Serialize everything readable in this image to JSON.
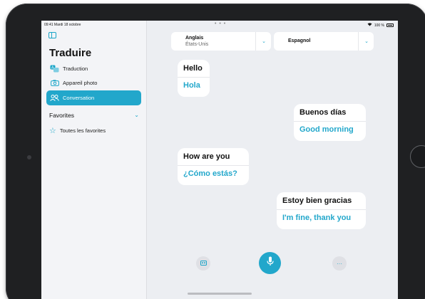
{
  "status_bar": {
    "time_date": "09:41  Mardi 18 octobre",
    "dots": "• • •",
    "battery": "100 %"
  },
  "sidebar": {
    "title": "Traduire",
    "items": [
      {
        "label": "Traduction",
        "icon": "translate-icon"
      },
      {
        "label": "Appareil photo",
        "icon": "camera-icon"
      },
      {
        "label": "Conversation",
        "icon": "people-icon",
        "active": true
      }
    ],
    "favorites": {
      "header": "Favorites",
      "items": [
        {
          "label": "Toutes les favorites",
          "icon": "star-icon"
        }
      ]
    }
  },
  "languages": {
    "source": {
      "name": "Anglais",
      "region": "États-Unis"
    },
    "target": {
      "name": "Espagnol"
    }
  },
  "conversation": [
    {
      "original": "Hello",
      "translation": "Hola"
    },
    {
      "original": "Buenos días",
      "translation": "Good morning"
    },
    {
      "original": "How are you",
      "translation": "¿Cómo estás?"
    },
    {
      "original": "Estoy bien gracias",
      "translation": "I'm fine, thank you"
    }
  ],
  "controls": {
    "view_icon": "view-mode-icon",
    "mic_icon": "microphone-icon",
    "more_icon": "ellipsis-icon",
    "more_label": "···"
  },
  "colors": {
    "accent": "#22a7cb",
    "background": "#eceef2",
    "sidebar": "#f3f4f7"
  }
}
